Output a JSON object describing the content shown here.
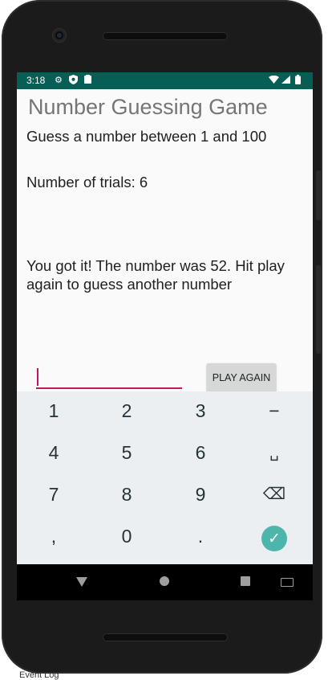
{
  "status_bar": {
    "time": "3:18",
    "left_icons": [
      "gear-icon",
      "shield-icon",
      "clipboard-icon"
    ],
    "right_icons": [
      "wifi-icon",
      "signal-icon",
      "battery-icon"
    ]
  },
  "app": {
    "title": "Number Guessing Game",
    "instruction": "Guess a number between 1 and 100",
    "trials": "Number of trials: 6",
    "result": "You got it! The number was 52. Hit play again to guess another number"
  },
  "input": {
    "value": "",
    "placeholder": ""
  },
  "play_again_label": "PLAY AGAIN",
  "keyboard": {
    "keys": [
      "1",
      "2",
      "3",
      "−",
      "4",
      "5",
      "6",
      "␣",
      "7",
      "8",
      "9",
      "⌫",
      ",",
      "0",
      ".",
      "✓"
    ]
  },
  "bottom_label": "Event Log",
  "colors": {
    "status_bar": "#075e54",
    "accent": "#c2185b",
    "done_key": "#4db6ac"
  }
}
